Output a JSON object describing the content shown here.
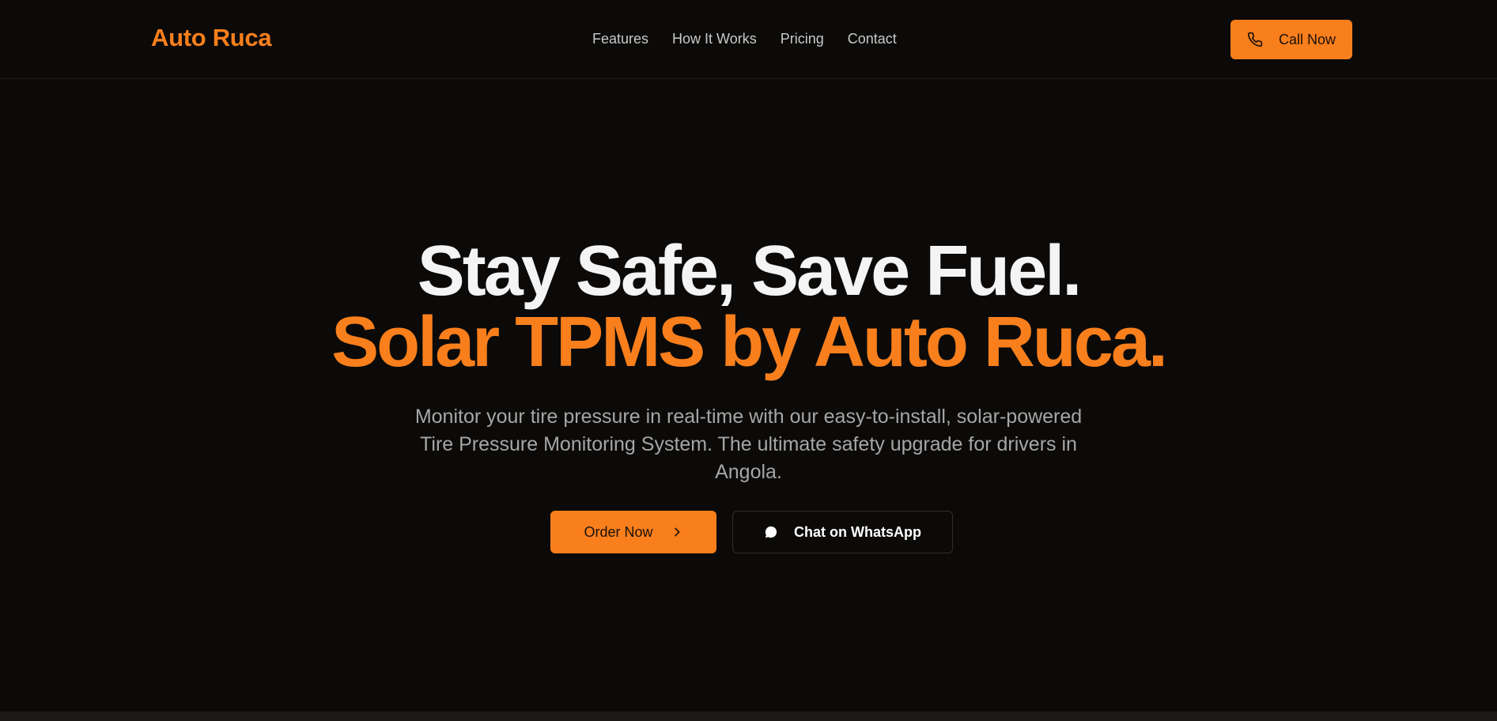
{
  "header": {
    "logo": "Auto Ruca",
    "nav": [
      {
        "label": "Features"
      },
      {
        "label": "How It Works"
      },
      {
        "label": "Pricing"
      },
      {
        "label": "Contact"
      }
    ],
    "call_button": {
      "label": "Call Now",
      "icon": "phone-icon"
    }
  },
  "hero": {
    "title_line1": "Stay Safe, Save Fuel.",
    "title_line2": "Solar TPMS by Auto Ruca.",
    "subtitle": "Monitor your tire pressure in real-time with our easy-to-install, solar-powered Tire Pressure Monitoring System. The ultimate safety upgrade for drivers in Angola.",
    "order_button": {
      "label": "Order Now",
      "icon": "chevron-right-icon"
    },
    "whatsapp_button": {
      "label": "Chat on WhatsApp",
      "icon": "chat-bubble-icon"
    }
  },
  "colors": {
    "accent": "#f97f1c",
    "background": "#0b0a09",
    "text": "#f4f4f4",
    "muted": "#a6a6a6"
  }
}
